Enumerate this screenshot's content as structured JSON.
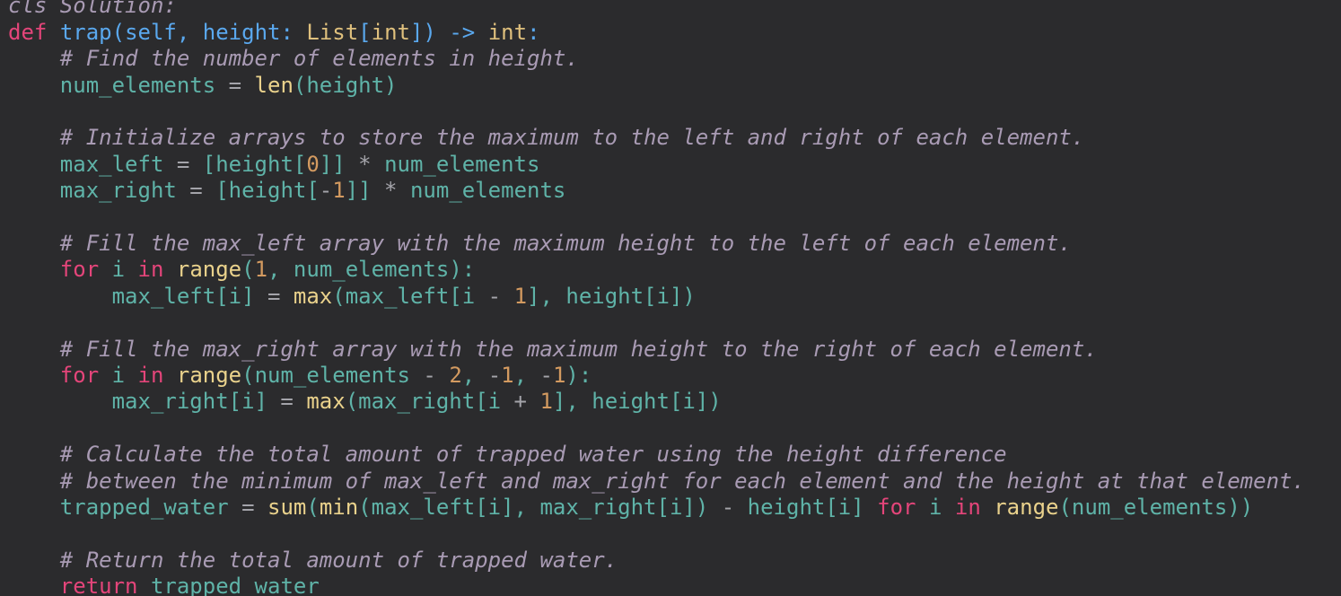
{
  "editor": {
    "language": "python",
    "colors": {
      "background": "#2b2b2d",
      "keyword": "#e4457a",
      "function": "#5aa8ee",
      "param": "#5aa8ee",
      "type": "#dfc07d",
      "builtin": "#ead28c",
      "number": "#d39a60",
      "comment": "#a99bb4",
      "identifier": "#5fb3a8",
      "operator": "#a4a4aa"
    },
    "lines": [
      {
        "tokens": [
          {
            "t": "cls Solution:",
            "k": "comment"
          }
        ]
      },
      {
        "tokens": [
          {
            "t": "def",
            "k": "keyword"
          },
          {
            "t": " "
          },
          {
            "t": "trap",
            "k": "function"
          },
          {
            "t": "(",
            "k": "function"
          },
          {
            "t": "self",
            "k": "param"
          },
          {
            "t": ", ",
            "k": "function"
          },
          {
            "t": "height",
            "k": "param"
          },
          {
            "t": ": ",
            "k": "function"
          },
          {
            "t": "List",
            "k": "type"
          },
          {
            "t": "[",
            "k": "function"
          },
          {
            "t": "int",
            "k": "type"
          },
          {
            "t": "]) ",
            "k": "function"
          },
          {
            "t": "->",
            "k": "function"
          },
          {
            "t": " "
          },
          {
            "t": "int",
            "k": "type"
          },
          {
            "t": ":",
            "k": "function"
          }
        ]
      },
      {
        "tokens": [
          {
            "t": "    "
          },
          {
            "t": "# Find the number of elements in height.",
            "k": "comment"
          }
        ]
      },
      {
        "tokens": [
          {
            "t": "    "
          },
          {
            "t": "num_elements",
            "k": "identifier"
          },
          {
            "t": " = ",
            "k": "operator"
          },
          {
            "t": "len",
            "k": "builtin"
          },
          {
            "t": "(height)",
            "k": "identifier"
          }
        ]
      },
      {
        "tokens": []
      },
      {
        "tokens": [
          {
            "t": "    "
          },
          {
            "t": "# Initialize arrays to store the maximum to the left and right of each element.",
            "k": "comment"
          }
        ]
      },
      {
        "tokens": [
          {
            "t": "    "
          },
          {
            "t": "max_left",
            "k": "identifier"
          },
          {
            "t": " = ",
            "k": "operator"
          },
          {
            "t": "[height[",
            "k": "identifier"
          },
          {
            "t": "0",
            "k": "number"
          },
          {
            "t": "]]",
            "k": "identifier"
          },
          {
            "t": " * ",
            "k": "operator"
          },
          {
            "t": "num_elements",
            "k": "identifier"
          }
        ]
      },
      {
        "tokens": [
          {
            "t": "    "
          },
          {
            "t": "max_right",
            "k": "identifier"
          },
          {
            "t": " = ",
            "k": "operator"
          },
          {
            "t": "[height[",
            "k": "identifier"
          },
          {
            "t": "-",
            "k": "operator"
          },
          {
            "t": "1",
            "k": "number"
          },
          {
            "t": "]]",
            "k": "identifier"
          },
          {
            "t": " * ",
            "k": "operator"
          },
          {
            "t": "num_elements",
            "k": "identifier"
          }
        ]
      },
      {
        "tokens": []
      },
      {
        "tokens": [
          {
            "t": "    "
          },
          {
            "t": "# Fill the max_left array with the maximum height to the left of each element.",
            "k": "comment"
          }
        ]
      },
      {
        "tokens": [
          {
            "t": "    "
          },
          {
            "t": "for",
            "k": "keyword"
          },
          {
            "t": " i ",
            "k": "identifier"
          },
          {
            "t": "in",
            "k": "keyword"
          },
          {
            "t": " "
          },
          {
            "t": "range",
            "k": "builtin"
          },
          {
            "t": "(",
            "k": "identifier"
          },
          {
            "t": "1",
            "k": "number"
          },
          {
            "t": ", num_elements):",
            "k": "identifier"
          }
        ]
      },
      {
        "tokens": [
          {
            "t": "        "
          },
          {
            "t": "max_left[i]",
            "k": "identifier"
          },
          {
            "t": " = ",
            "k": "operator"
          },
          {
            "t": "max",
            "k": "builtin"
          },
          {
            "t": "(max_left[i ",
            "k": "identifier"
          },
          {
            "t": "-",
            "k": "operator"
          },
          {
            "t": " "
          },
          {
            "t": "1",
            "k": "number"
          },
          {
            "t": "], height[i])",
            "k": "identifier"
          }
        ]
      },
      {
        "tokens": []
      },
      {
        "tokens": [
          {
            "t": "    "
          },
          {
            "t": "# Fill the max_right array with the maximum height to the right of each element.",
            "k": "comment"
          }
        ]
      },
      {
        "tokens": [
          {
            "t": "    "
          },
          {
            "t": "for",
            "k": "keyword"
          },
          {
            "t": " i ",
            "k": "identifier"
          },
          {
            "t": "in",
            "k": "keyword"
          },
          {
            "t": " "
          },
          {
            "t": "range",
            "k": "builtin"
          },
          {
            "t": "(num_elements ",
            "k": "identifier"
          },
          {
            "t": "-",
            "k": "operator"
          },
          {
            "t": " "
          },
          {
            "t": "2",
            "k": "number"
          },
          {
            "t": ", ",
            "k": "identifier"
          },
          {
            "t": "-",
            "k": "operator"
          },
          {
            "t": "1",
            "k": "number"
          },
          {
            "t": ", ",
            "k": "identifier"
          },
          {
            "t": "-",
            "k": "operator"
          },
          {
            "t": "1",
            "k": "number"
          },
          {
            "t": "):",
            "k": "identifier"
          }
        ]
      },
      {
        "tokens": [
          {
            "t": "        "
          },
          {
            "t": "max_right[i]",
            "k": "identifier"
          },
          {
            "t": " = ",
            "k": "operator"
          },
          {
            "t": "max",
            "k": "builtin"
          },
          {
            "t": "(max_right[i ",
            "k": "identifier"
          },
          {
            "t": "+",
            "k": "operator"
          },
          {
            "t": " "
          },
          {
            "t": "1",
            "k": "number"
          },
          {
            "t": "], height[i])",
            "k": "identifier"
          }
        ]
      },
      {
        "tokens": []
      },
      {
        "tokens": [
          {
            "t": "    "
          },
          {
            "t": "# Calculate the total amount of trapped water using the height difference",
            "k": "comment"
          }
        ]
      },
      {
        "tokens": [
          {
            "t": "    "
          },
          {
            "t": "# between the minimum of max_left and max_right for each element and the height at that element.",
            "k": "comment"
          }
        ]
      },
      {
        "tokens": [
          {
            "t": "    "
          },
          {
            "t": "trapped_water",
            "k": "identifier"
          },
          {
            "t": " = ",
            "k": "operator"
          },
          {
            "t": "sum",
            "k": "builtin"
          },
          {
            "t": "(",
            "k": "identifier"
          },
          {
            "t": "min",
            "k": "builtin"
          },
          {
            "t": "(max_left[i], max_right[i]) ",
            "k": "identifier"
          },
          {
            "t": "-",
            "k": "operator"
          },
          {
            "t": " height[i] ",
            "k": "identifier"
          },
          {
            "t": "for",
            "k": "keyword"
          },
          {
            "t": " i ",
            "k": "identifier"
          },
          {
            "t": "in",
            "k": "keyword"
          },
          {
            "t": " "
          },
          {
            "t": "range",
            "k": "builtin"
          },
          {
            "t": "(num_elements))",
            "k": "identifier"
          }
        ]
      },
      {
        "tokens": []
      },
      {
        "tokens": [
          {
            "t": "    "
          },
          {
            "t": "# Return the total amount of trapped water.",
            "k": "comment"
          }
        ]
      },
      {
        "tokens": [
          {
            "t": "    "
          },
          {
            "t": "return",
            "k": "keyword"
          },
          {
            "t": " "
          },
          {
            "t": "trapped_water",
            "k": "identifier"
          }
        ]
      }
    ]
  }
}
